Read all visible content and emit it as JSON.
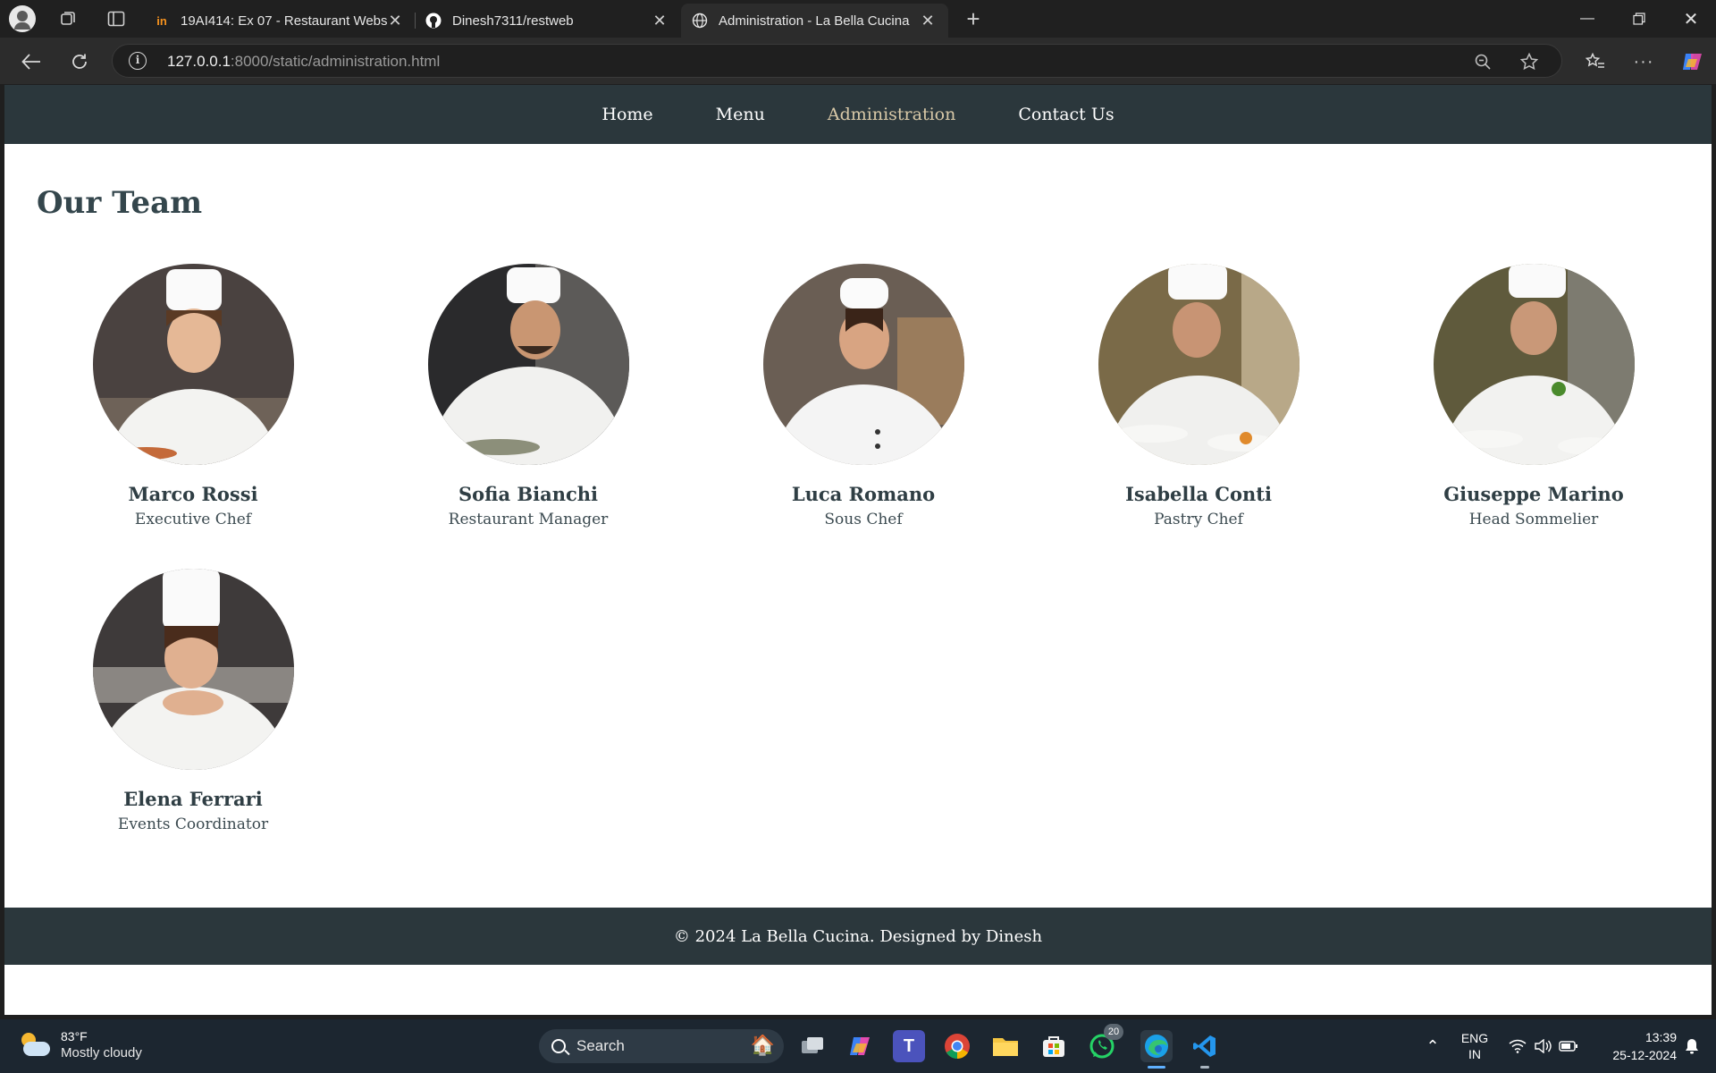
{
  "browser": {
    "tabs": [
      {
        "favicon": "in",
        "title": "19AI414: Ex 07 - Restaurant Webs"
      },
      {
        "favicon": "github-icon",
        "title": "Dinesh7311/restweb"
      },
      {
        "favicon": "globe-icon",
        "title": "Administration - La Bella Cucina"
      }
    ],
    "url_host": "127.0.0.1",
    "url_rest": ":8000/static/administration.html"
  },
  "site": {
    "nav": [
      "Home",
      "Menu",
      "Administration",
      "Contact Us"
    ],
    "active_nav": "Administration",
    "heading": "Our Team",
    "team": [
      {
        "name": "Marco Rossi",
        "role": "Executive Chef"
      },
      {
        "name": "Sofia Bianchi",
        "role": "Restaurant Manager"
      },
      {
        "name": "Luca Romano",
        "role": "Sous Chef"
      },
      {
        "name": "Isabella Conti",
        "role": "Pastry Chef"
      },
      {
        "name": "Giuseppe Marino",
        "role": "Head Sommelier"
      },
      {
        "name": "Elena Ferrari",
        "role": "Events Coordinator"
      }
    ],
    "footer": "© 2024 La Bella Cucina. Designed by Dinesh"
  },
  "taskbar": {
    "weather_temp": "83°F",
    "weather_desc": "Mostly cloudy",
    "search_label": "Search",
    "whatsapp_badge": "20",
    "lang_line1": "ENG",
    "lang_line2": "IN",
    "time": "13:39",
    "date": "25-12-2024"
  }
}
